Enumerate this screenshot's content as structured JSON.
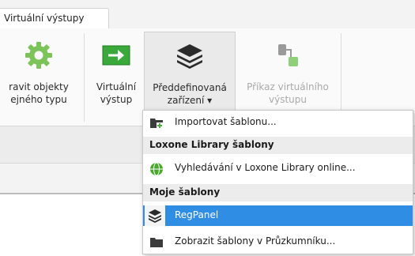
{
  "tab": {
    "label": "Virtuální výstupy"
  },
  "ribbon": {
    "buttons": [
      {
        "label1": "ravit objekty",
        "label2": "ejného typu"
      },
      {
        "label1": "Virtuální",
        "label2": "výstup"
      },
      {
        "label1": "Předdefinovaná",
        "label2": "zařízení ▾"
      },
      {
        "label1": "Příkaz virtuálního",
        "label2": "výstupu"
      }
    ]
  },
  "menu": {
    "import": "Importovat šablonu...",
    "header_library": "Loxone Library šablony",
    "search_library": "Vyhledávání v Loxone Library online...",
    "header_my": "Moje šablony",
    "regpanel": "RegPanel",
    "show_explorer": "Zobrazit šablony v Průzkumníku..."
  },
  "colors": {
    "accent": "#2f8de4",
    "green": "#59b02a",
    "gray_icon": "#8a8a8a"
  }
}
